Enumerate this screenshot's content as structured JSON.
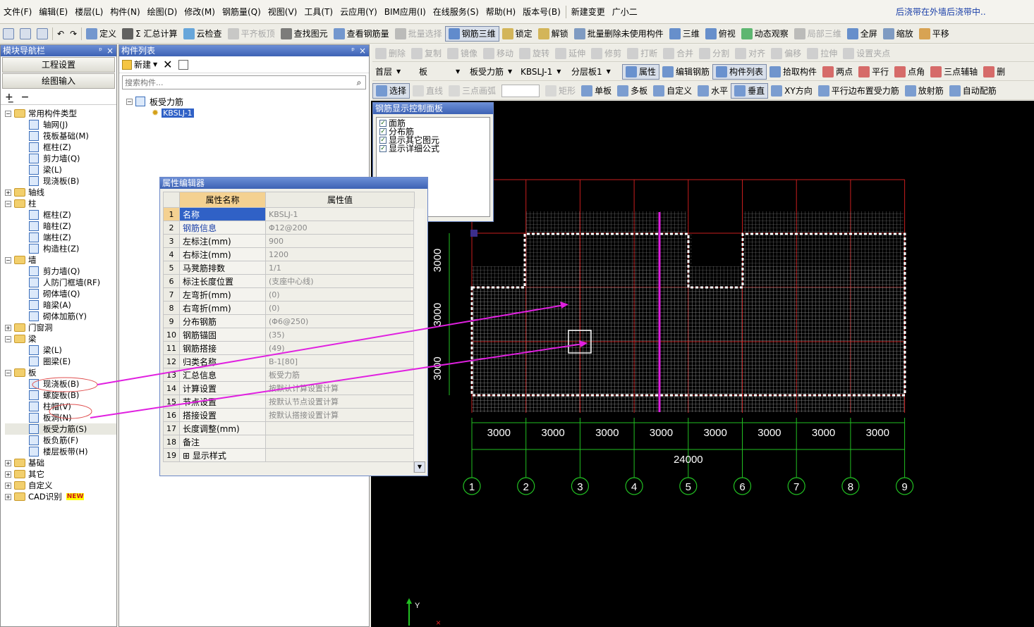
{
  "menu": [
    "文件(F)",
    "编辑(E)",
    "楼层(L)",
    "构件(N)",
    "绘图(D)",
    "修改(M)",
    "钢筋量(Q)",
    "视图(V)",
    "工具(T)",
    "云应用(Y)",
    "BIM应用(I)",
    "在线服务(S)",
    "帮助(H)",
    "版本号(B)",
    "新建变更",
    "广小二"
  ],
  "marquee": "后浇带在外墙后浇带中..",
  "toolbar1": [
    "定义",
    "Σ 汇总计算",
    "云检查",
    "平齐板顶",
    "查找图元",
    "查看钢筋量",
    "批量选择",
    "钢筋三维",
    "锁定",
    "解锁",
    "批量删除未使用构件",
    "三维",
    "俯视",
    "动态观察",
    "局部三维",
    "全屏",
    "缩放",
    "平移"
  ],
  "edit_toolbar": [
    "删除",
    "复制",
    "镜像",
    "移动",
    "旋转",
    "延伸",
    "修剪",
    "打断",
    "合并",
    "分割",
    "对齐",
    "偏移",
    "拉伸",
    "设置夹点"
  ],
  "selectors": {
    "floor": "首层",
    "type": "板",
    "subtype": "板受力筋",
    "name": "KBSLJ-1",
    "layer": "分层板1"
  },
  "toolbar3": [
    "属性",
    "编辑钢筋",
    "构件列表",
    "拾取构件",
    "两点",
    "平行",
    "点角",
    "三点辅轴",
    "删"
  ],
  "toolbar4": [
    "选择",
    "直线",
    "三点画弧",
    "矩形",
    "单板",
    "多板",
    "自定义",
    "水平",
    "垂直",
    "XY方向",
    "平行边布置受力筋",
    "放射筋",
    "自动配筋"
  ],
  "nav": {
    "title": "模块导航栏",
    "btn_project": "工程设置",
    "btn_draw": "绘图输入",
    "tree": [
      {
        "lvl": 0,
        "exp": "−",
        "label": "常用构件类型",
        "folder": true
      },
      {
        "lvl": 2,
        "label": "轴网(J)"
      },
      {
        "lvl": 2,
        "label": "筏板基础(M)"
      },
      {
        "lvl": 2,
        "label": "框柱(Z)"
      },
      {
        "lvl": 2,
        "label": "剪力墙(Q)"
      },
      {
        "lvl": 2,
        "label": "梁(L)"
      },
      {
        "lvl": 2,
        "label": "现浇板(B)"
      },
      {
        "lvl": 0,
        "exp": "+",
        "label": "轴线",
        "folder": true
      },
      {
        "lvl": 0,
        "exp": "−",
        "label": "柱",
        "folder": true
      },
      {
        "lvl": 2,
        "label": "框柱(Z)"
      },
      {
        "lvl": 2,
        "label": "暗柱(Z)"
      },
      {
        "lvl": 2,
        "label": "端柱(Z)"
      },
      {
        "lvl": 2,
        "label": "构造柱(Z)"
      },
      {
        "lvl": 0,
        "exp": "−",
        "label": "墙",
        "folder": true
      },
      {
        "lvl": 2,
        "label": "剪力墙(Q)"
      },
      {
        "lvl": 2,
        "label": "人防门框墙(RF)"
      },
      {
        "lvl": 2,
        "label": "砌体墙(Q)"
      },
      {
        "lvl": 2,
        "label": "暗梁(A)"
      },
      {
        "lvl": 2,
        "label": "砌体加筋(Y)"
      },
      {
        "lvl": 0,
        "exp": "+",
        "label": "门窗洞",
        "folder": true
      },
      {
        "lvl": 0,
        "exp": "−",
        "label": "梁",
        "folder": true
      },
      {
        "lvl": 2,
        "label": "梁(L)"
      },
      {
        "lvl": 2,
        "label": "圈梁(E)"
      },
      {
        "lvl": 0,
        "exp": "−",
        "label": "板",
        "folder": true
      },
      {
        "lvl": 2,
        "label": "现浇板(B)"
      },
      {
        "lvl": 2,
        "label": "螺旋板(B)"
      },
      {
        "lvl": 2,
        "label": "柱帽(V)"
      },
      {
        "lvl": 2,
        "label": "板洞(N)"
      },
      {
        "lvl": 2,
        "label": "板受力筋(S)"
      },
      {
        "lvl": 2,
        "label": "板负筋(F)"
      },
      {
        "lvl": 2,
        "label": "楼层板带(H)"
      },
      {
        "lvl": 0,
        "exp": "+",
        "label": "基础",
        "folder": true
      },
      {
        "lvl": 0,
        "exp": "+",
        "label": "其它",
        "folder": true
      },
      {
        "lvl": 0,
        "exp": "+",
        "label": "自定义",
        "folder": true
      },
      {
        "lvl": 0,
        "exp": "+",
        "label": "CAD识别",
        "folder": true,
        "badge": "NEW"
      }
    ]
  },
  "complist": {
    "title": "构件列表",
    "new_label": "新建",
    "search_placeholder": "搜索构件...",
    "root": "板受力筋",
    "child": "KBSLJ-1"
  },
  "rebar_panel": {
    "title": "钢筋显示控制面板",
    "items": [
      "面筋",
      "分布筋",
      "显示其它图元",
      "显示详细公式"
    ]
  },
  "prop": {
    "title": "属性编辑器",
    "col_name": "属性名称",
    "col_value": "属性值",
    "rows": [
      {
        "no": "1",
        "name": "名称",
        "value": "KBSLJ-1",
        "sel": true
      },
      {
        "no": "2",
        "name": "钢筋信息",
        "value": "Φ12@200",
        "blue": true
      },
      {
        "no": "3",
        "name": "左标注(mm)",
        "value": "900"
      },
      {
        "no": "4",
        "name": "右标注(mm)",
        "value": "1200"
      },
      {
        "no": "5",
        "name": "马凳筋排数",
        "value": "1/1"
      },
      {
        "no": "6",
        "name": "标注长度位置",
        "value": "(支座中心线)"
      },
      {
        "no": "7",
        "name": "左弯折(mm)",
        "value": "(0)"
      },
      {
        "no": "8",
        "name": "右弯折(mm)",
        "value": "(0)"
      },
      {
        "no": "9",
        "name": "分布钢筋",
        "value": "(Φ6@250)"
      },
      {
        "no": "10",
        "name": "钢筋锚固",
        "value": "(35)"
      },
      {
        "no": "11",
        "name": "钢筋搭接",
        "value": "(49)"
      },
      {
        "no": "12",
        "name": "归类名称",
        "value": "B-1[80]"
      },
      {
        "no": "13",
        "name": "汇总信息",
        "value": "板受力筋"
      },
      {
        "no": "14",
        "name": "计算设置",
        "value": "按默认计算设置计算"
      },
      {
        "no": "15",
        "name": "节点设置",
        "value": "按默认节点设置计算"
      },
      {
        "no": "16",
        "name": "搭接设置",
        "value": "按默认搭接设置计算"
      },
      {
        "no": "17",
        "name": "长度调整(mm)",
        "value": ""
      },
      {
        "no": "18",
        "name": "备注",
        "value": ""
      },
      {
        "no": "19",
        "name": "⊞ 显示样式",
        "value": ""
      }
    ]
  },
  "drawing": {
    "dims_bottom": [
      "3000",
      "3000",
      "3000",
      "3000",
      "3000",
      "3000",
      "3000",
      "3000"
    ],
    "total": "24000",
    "axes": [
      "1",
      "2",
      "3",
      "4",
      "5",
      "6",
      "7",
      "8",
      "9"
    ],
    "dims_left": [
      "3000",
      "3000",
      "3000"
    ],
    "ucs_y": "Y"
  },
  "colors": {
    "accent": "#3061c6",
    "magenta": "#e020e0",
    "grid": "#c81e1e",
    "green": "#22c022"
  }
}
